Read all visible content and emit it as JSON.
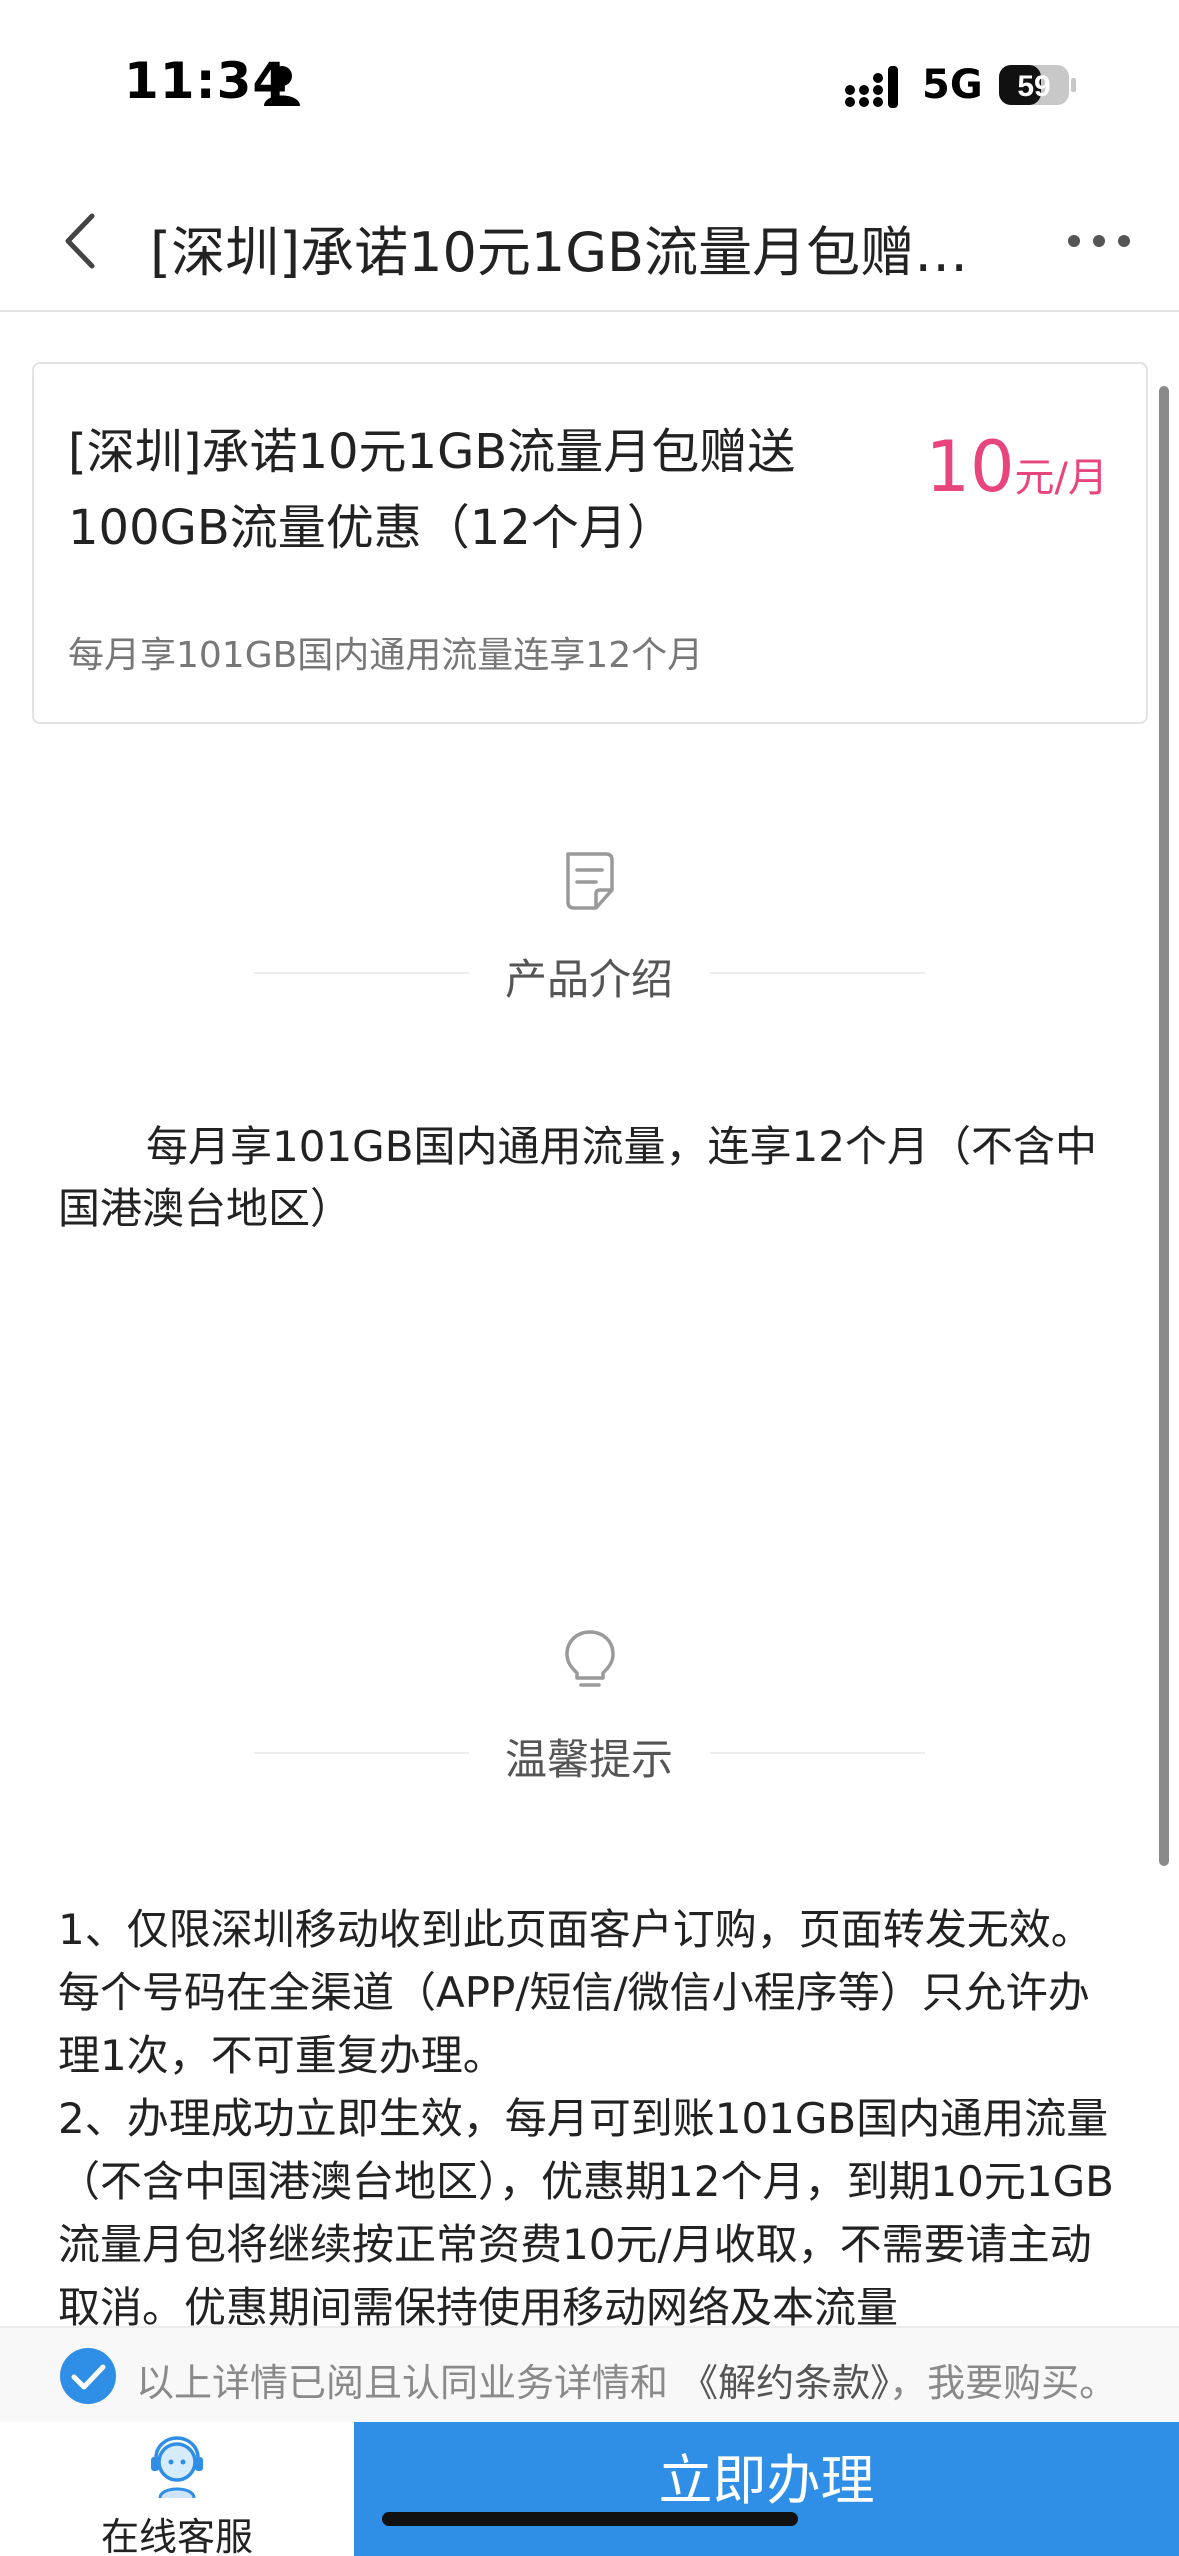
{
  "status_bar": {
    "time": "11:34",
    "network": "5G",
    "battery": "59"
  },
  "nav": {
    "title": "[深圳]承诺10元1GB流量月包赠…"
  },
  "product": {
    "title_line1": "[深圳]承诺10元1GB流量月包赠送",
    "title_line2": "100GB流量优惠（12个月）",
    "price_value": "10",
    "price_unit": "元/月",
    "subtitle": "每月享101GB国内通用流量连享12个月",
    "accent_color": "#e8457e"
  },
  "intro": {
    "heading": "产品介绍",
    "icon": "document-icon",
    "text": "每月享101GB国内通用流量，连享12个月（不含中国港澳台地区）"
  },
  "tips": {
    "heading": "温馨提示",
    "icon": "lightbulb-icon",
    "paragraphs": [
      "1、仅限深圳移动收到此页面客户订购，页面转发无效。每个号码在全渠道（APP/短信/微信小程序等）只允许办理1次，不可重复办理。",
      "2、办理成功立即生效，每月可到账101GB国内通用流量（不含中国港澳台地区），优惠期12个月，到期10元1GB流量月包将继续按正常资费10元/月收取，不需要请主动取消。优惠期间需保持使用移动网络及本流量"
    ]
  },
  "agreement": {
    "prefix": "以上详情已阅且认同业务详情和",
    "link": "《解约条款》",
    "suffix": "，我要购买。",
    "checked": true
  },
  "bottom": {
    "service_label": "在线客服",
    "submit_label": "立即办理",
    "submit_color": "#2f8ee5"
  }
}
